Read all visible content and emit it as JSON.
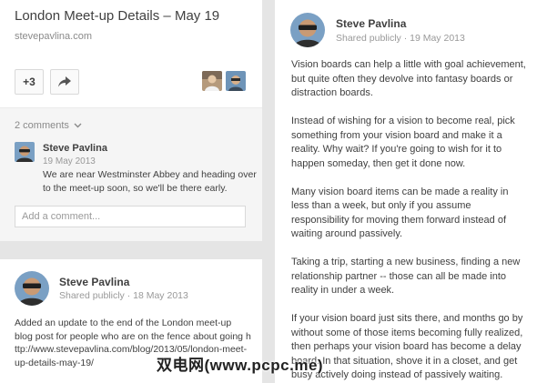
{
  "left_card": {
    "title": "London Meet-up Details – May 19",
    "source": "stevepavlina.com",
    "plus_label": "+3",
    "share_icon": "share-arrow-icon",
    "comments_toggle": "2 comments",
    "comment": {
      "author": "Steve Pavlina",
      "date": "19 May 2013",
      "text": "We are near Westminster Abbey and heading over to the meet-up soon, so we'll be there early."
    },
    "add_comment_placeholder": "Add a comment..."
  },
  "second_card": {
    "author": "Steve Pavlina",
    "meta": "Shared publicly  ·  18 May 2013",
    "body": "Added an update to the end of the London meet-up blog post for people who are on the fence about going",
    "link": "http://www.stevepavlina.com/blog/2013/05/london-meet-up-details-may-19/"
  },
  "right_post": {
    "author": "Steve Pavlina",
    "meta": "Shared publicly  ·  19 May 2013",
    "paragraphs": [
      "Vision boards can help a little with goal achievement, but quite often they devolve into fantasy boards or distraction boards.",
      "Instead of wishing for a vision to become real, pick something from your vision board and make it a reality. Why wait? If you're going to wish for it to happen someday, then get it done now.",
      "Many vision board items can be made a reality in less than a week, but only if you assume responsibility for moving them forward instead of waiting around passively.",
      "Taking a trip, starting a new business, finding a new relationship partner -- those can all be made into reality in under a week.",
      "If your vision board just sits there, and months go by without some of those items becoming fully realized, then perhaps your vision board has become a delay board. In that situation, shove it in a closet, and get busy actively doing instead of passively waiting."
    ]
  },
  "watermark": "双电网(www.pcpc.me)",
  "colors": {
    "page_bg": "#e5e5e5",
    "card_bg": "#ffffff",
    "comments_bg": "#f5f5f5",
    "text": "#404040",
    "muted": "#999999"
  }
}
